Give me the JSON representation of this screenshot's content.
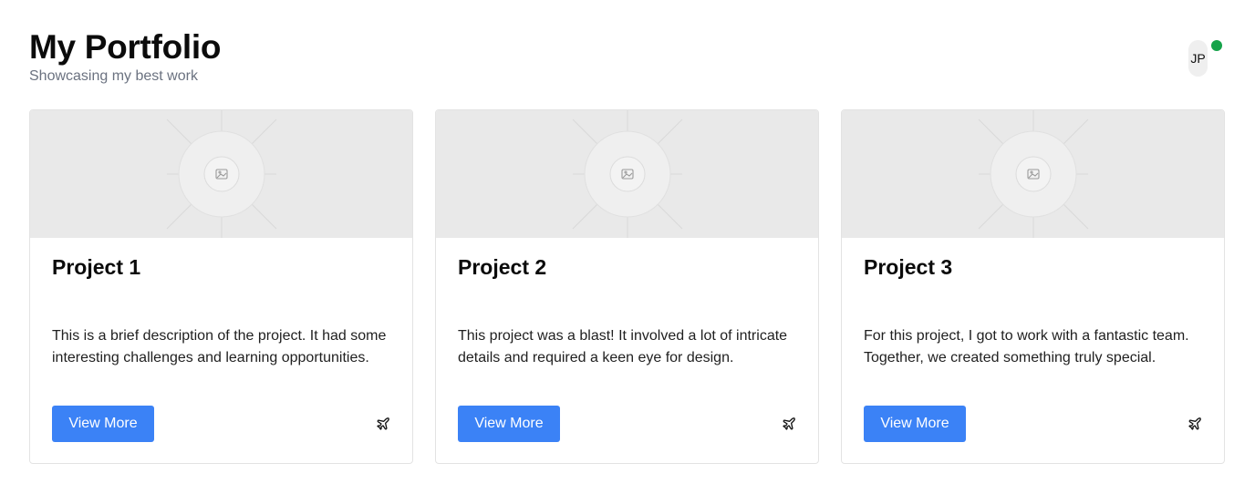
{
  "header": {
    "title": "My Portfolio",
    "subtitle": "Showcasing my best work",
    "avatar_initials": "JP",
    "status_color": "#16a34a"
  },
  "projects": [
    {
      "title": "Project 1",
      "description": "This is a brief description of the project. It had some interesting challenges and learning opportunities.",
      "button_label": "View More",
      "image_icon": "image-placeholder-icon",
      "action_icon": "airplane-icon"
    },
    {
      "title": "Project 2",
      "description": "This project was a blast! It involved a lot of intricate details and required a keen eye for design.",
      "button_label": "View More",
      "image_icon": "image-placeholder-icon",
      "action_icon": "airplane-icon"
    },
    {
      "title": "Project 3",
      "description": "For this project, I got to work with a fantastic team. Together, we created something truly special.",
      "button_label": "View More",
      "image_icon": "image-placeholder-icon",
      "action_icon": "airplane-icon"
    }
  ],
  "colors": {
    "accent": "#3b82f6",
    "placeholder_bg": "#e9e9e9"
  }
}
